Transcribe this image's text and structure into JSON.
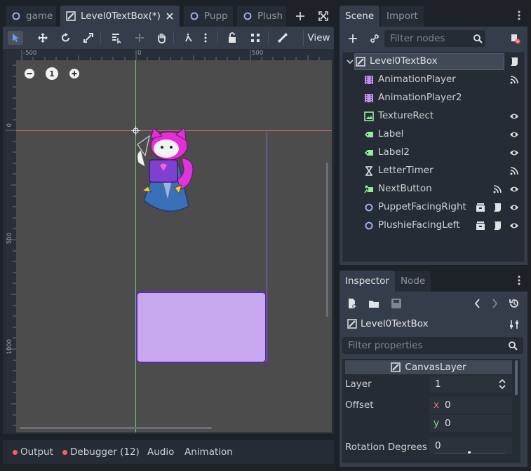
{
  "editor_tabs": [
    {
      "label": "game",
      "icon": "circle-node-icon"
    },
    {
      "label": "Level0TextBox(*)",
      "icon": "canvas-layer-icon"
    },
    {
      "label": "Pupp",
      "icon": "circle-node-icon"
    },
    {
      "label": "Plush",
      "icon": "circle-node-icon"
    }
  ],
  "toolbar": {
    "view_label": "View",
    "tools": [
      "select-tool-icon",
      "move-tool-icon",
      "rotate-tool-icon",
      "scale-tool-icon",
      "list-select-icon",
      "pivot-icon",
      "pan-icon",
      "snap-icon",
      "more-icon",
      "lock-icon",
      "group-icon",
      "bone-icon"
    ]
  },
  "viewport": {
    "zoom_label": "1",
    "ruler_h": [
      "-500",
      "0",
      "500"
    ],
    "ruler_v": [
      "0",
      "500",
      "1000"
    ]
  },
  "bottom_tabs": [
    {
      "label": "Output",
      "has_dot": true
    },
    {
      "label": "Debugger (12)",
      "has_dot": true
    },
    {
      "label": "Audio",
      "has_dot": false
    },
    {
      "label": "Animation",
      "has_dot": false
    }
  ],
  "scene_dock": {
    "tabs": [
      "Scene",
      "Import"
    ],
    "filter_placeholder": "Filter nodes",
    "nodes": [
      {
        "name": "Level0TextBox",
        "icon": "canvas-layer-icon",
        "root": true
      },
      {
        "name": "AnimationPlayer",
        "icon": "animation-player-icon"
      },
      {
        "name": "AnimationPlayer2",
        "icon": "animation-player-icon"
      },
      {
        "name": "TextureRect",
        "icon": "texture-rect-icon"
      },
      {
        "name": "Label",
        "icon": "label-icon"
      },
      {
        "name": "Label2",
        "icon": "label-icon"
      },
      {
        "name": "LetterTimer",
        "icon": "timer-icon"
      },
      {
        "name": "NextButton",
        "icon": "button-icon"
      },
      {
        "name": "PuppetFacingRight",
        "icon": "circle-node-icon"
      },
      {
        "name": "PlushieFacingLeft",
        "icon": "circle-node-icon"
      }
    ]
  },
  "inspector": {
    "tabs": [
      "Inspector",
      "Node"
    ],
    "object_name": "Level0TextBox",
    "filter_placeholder": "Filter properties",
    "section": "CanvasLayer",
    "layer_label": "Layer",
    "layer_value": "1",
    "offset_label": "Offset",
    "offset_x_axis": "x",
    "offset_x": "0",
    "offset_y_axis": "y",
    "offset_y": "0",
    "rotation_label": "Rotation Degrees",
    "rotation_value": "0"
  },
  "colors": {
    "accent": "#699ce8",
    "panel_bg": "#363d4a",
    "dark_bg": "#262c35",
    "node_green": "#8eef97",
    "node_purple": "#c38ef1",
    "node_blue": "#a5b7f3",
    "textbox_fill": "#c7a8ef",
    "textbox_border": "#5b2bb4"
  }
}
